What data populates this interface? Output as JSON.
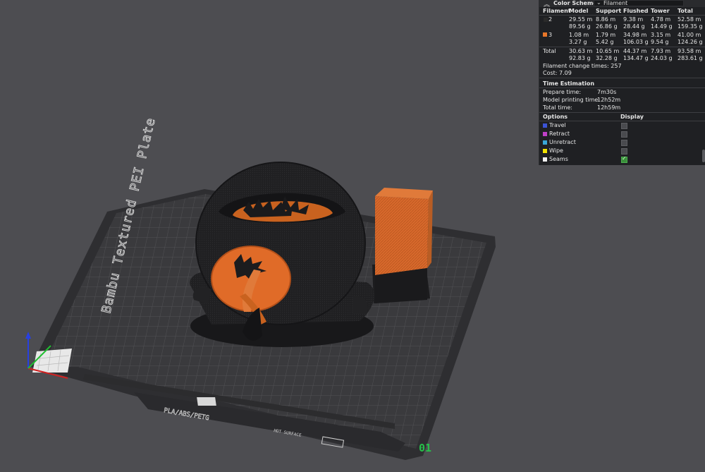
{
  "color_scheme": {
    "title": "Color Scheme",
    "selected": "Filament"
  },
  "filament_table": {
    "headers": [
      "Filament",
      "Model",
      "Support",
      "Flushed",
      "Tower",
      "Total"
    ],
    "rows": [
      {
        "id": "2",
        "color": "#2a2a2a",
        "meters": [
          "29.55 m",
          "8.86 m",
          "9.38 m",
          "4.78 m",
          "52.58 m"
        ],
        "grams": [
          "89.56 g",
          "26.86 g",
          "28.44 g",
          "14.49 g",
          "159.35 g"
        ]
      },
      {
        "id": "3",
        "color": "#e8772a",
        "meters": [
          "1.08 m",
          "1.79 m",
          "34.98 m",
          "3.15 m",
          "41.00 m"
        ],
        "grams": [
          "3.27 g",
          "5.42 g",
          "106.03 g",
          "9.54 g",
          "124.26 g"
        ]
      }
    ],
    "total": {
      "label": "Total",
      "meters": [
        "30.63 m",
        "10.65 m",
        "44.37 m",
        "7.93 m",
        "93.58 m"
      ],
      "grams": [
        "92.83 g",
        "32.28 g",
        "134.47 g",
        "24.03 g",
        "283.61 g"
      ]
    },
    "change_times": "Filament change times: 257",
    "cost": "Cost: 7.09"
  },
  "time_estimation": {
    "title": "Time Estimation",
    "rows": [
      {
        "label": "Prepare time:",
        "value": "7m30s"
      },
      {
        "label": "Model printing time:",
        "value": "12h52m"
      },
      {
        "label": "Total time:",
        "value": "12h59m"
      }
    ]
  },
  "options": {
    "headers": [
      "Options",
      "Display"
    ],
    "items": [
      {
        "label": "Travel",
        "color": "#3b53d6",
        "checked": false
      },
      {
        "label": "Retract",
        "color": "#c040c8",
        "checked": false
      },
      {
        "label": "Unretract",
        "color": "#3aa7d8",
        "checked": false
      },
      {
        "label": "Wipe",
        "color": "#f2e300",
        "checked": false
      },
      {
        "label": "Seams",
        "color": "#f2f2f2",
        "checked": true
      }
    ]
  },
  "plate": {
    "name": "Bambu Textured PEI Plate",
    "material_label": "PLA/ABS/PETG",
    "surface_label": "HOT SURFACE",
    "plate_number": "01"
  },
  "colors": {
    "background": "#4d4d51",
    "panel": "#1f2023",
    "orange": "#e07030",
    "plate_number": "#27c04a"
  }
}
